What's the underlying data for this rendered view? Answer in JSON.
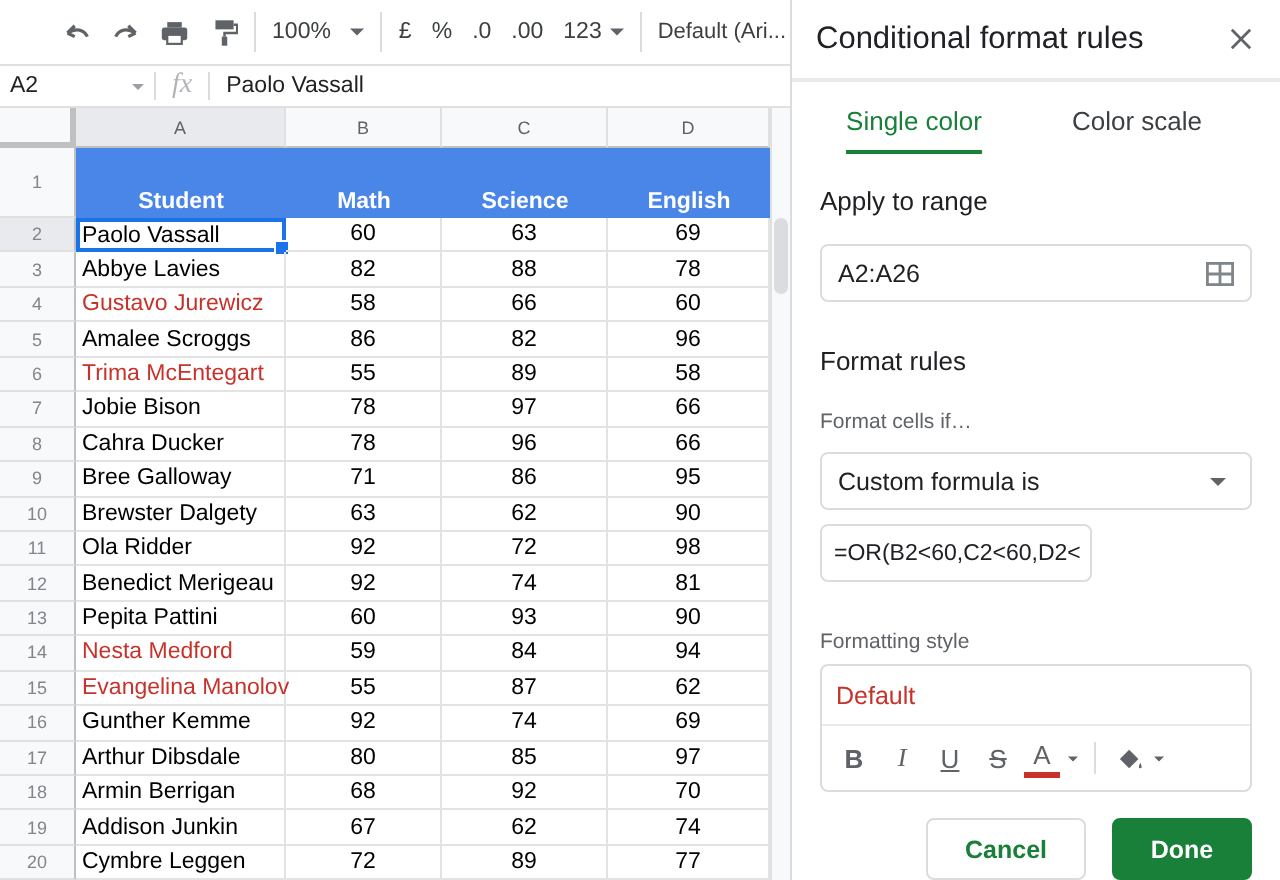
{
  "toolbar": {
    "zoom": "100%",
    "currency": "£",
    "percent": "%",
    "decrease_decimals": ".0",
    "increase_decimals": ".00",
    "number_format": "123",
    "font": "Default (Ari..."
  },
  "formula_bar": {
    "cell_ref": "A2",
    "fx": "fx",
    "value": "Paolo Vassall"
  },
  "columns": [
    {
      "label": "A",
      "selected": true
    },
    {
      "label": "B",
      "selected": false
    },
    {
      "label": "C",
      "selected": false
    },
    {
      "label": "D",
      "selected": false
    }
  ],
  "header_row": {
    "number": "1",
    "cells": [
      "Student",
      "Math",
      "Science",
      "English"
    ]
  },
  "rows": [
    {
      "number": "2",
      "name": "Paolo Vassall",
      "math": "60",
      "science": "63",
      "english": "69",
      "flagged": false,
      "selected": true
    },
    {
      "number": "3",
      "name": "Abbye Lavies",
      "math": "82",
      "science": "88",
      "english": "78",
      "flagged": false,
      "selected": false
    },
    {
      "number": "4",
      "name": "Gustavo Jurewicz",
      "math": "58",
      "science": "66",
      "english": "60",
      "flagged": true,
      "selected": false
    },
    {
      "number": "5",
      "name": "Amalee Scroggs",
      "math": "86",
      "science": "82",
      "english": "96",
      "flagged": false,
      "selected": false
    },
    {
      "number": "6",
      "name": "Trima McEntegart",
      "math": "55",
      "science": "89",
      "english": "58",
      "flagged": true,
      "selected": false
    },
    {
      "number": "7",
      "name": "Jobie Bison",
      "math": "78",
      "science": "97",
      "english": "66",
      "flagged": false,
      "selected": false
    },
    {
      "number": "8",
      "name": "Cahra Ducker",
      "math": "78",
      "science": "96",
      "english": "66",
      "flagged": false,
      "selected": false
    },
    {
      "number": "9",
      "name": "Bree Galloway",
      "math": "71",
      "science": "86",
      "english": "95",
      "flagged": false,
      "selected": false
    },
    {
      "number": "10",
      "name": "Brewster Dalgety",
      "math": "63",
      "science": "62",
      "english": "90",
      "flagged": false,
      "selected": false
    },
    {
      "number": "11",
      "name": "Ola Ridder",
      "math": "92",
      "science": "72",
      "english": "98",
      "flagged": false,
      "selected": false
    },
    {
      "number": "12",
      "name": "Benedict Merigeau",
      "math": "92",
      "science": "74",
      "english": "81",
      "flagged": false,
      "selected": false
    },
    {
      "number": "13",
      "name": "Pepita Pattini",
      "math": "60",
      "science": "93",
      "english": "90",
      "flagged": false,
      "selected": false
    },
    {
      "number": "14",
      "name": "Nesta Medford",
      "math": "59",
      "science": "84",
      "english": "94",
      "flagged": true,
      "selected": false
    },
    {
      "number": "15",
      "name": "Evangelina Manolov",
      "math": "55",
      "science": "87",
      "english": "62",
      "flagged": true,
      "selected": false
    },
    {
      "number": "16",
      "name": "Gunther Kemme",
      "math": "92",
      "science": "74",
      "english": "69",
      "flagged": false,
      "selected": false
    },
    {
      "number": "17",
      "name": "Arthur Dibsdale",
      "math": "80",
      "science": "85",
      "english": "97",
      "flagged": false,
      "selected": false
    },
    {
      "number": "18",
      "name": "Armin Berrigan",
      "math": "68",
      "science": "92",
      "english": "70",
      "flagged": false,
      "selected": false
    },
    {
      "number": "19",
      "name": "Addison Junkin",
      "math": "67",
      "science": "62",
      "english": "74",
      "flagged": false,
      "selected": false
    },
    {
      "number": "20",
      "name": "Cymbre Leggen",
      "math": "72",
      "science": "89",
      "english": "77",
      "flagged": false,
      "selected": false
    }
  ],
  "panel": {
    "title": "Conditional format rules",
    "tabs": [
      {
        "label": "Single color",
        "selected": true
      },
      {
        "label": "Color scale",
        "selected": false
      }
    ],
    "range_label": "Apply to range",
    "range_value": "A2:A26",
    "rules_heading": "Format rules",
    "condition_label": "Format cells if…",
    "condition": "Custom formula is",
    "formula": "=OR(B2<60,C2<60,D2<",
    "style_label": "Formatting style",
    "style_preview": "Default",
    "style_buttons": [
      {
        "kind": "bold",
        "label": "B"
      },
      {
        "kind": "italic",
        "label": "I"
      },
      {
        "kind": "underline",
        "label": "U"
      },
      {
        "kind": "strikethrough",
        "label": "S"
      },
      {
        "kind": "text_color",
        "label": "A"
      }
    ],
    "buttons": [
      {
        "kind": "secondary",
        "label": "Cancel"
      },
      {
        "kind": "primary",
        "label": "Done"
      }
    ]
  }
}
